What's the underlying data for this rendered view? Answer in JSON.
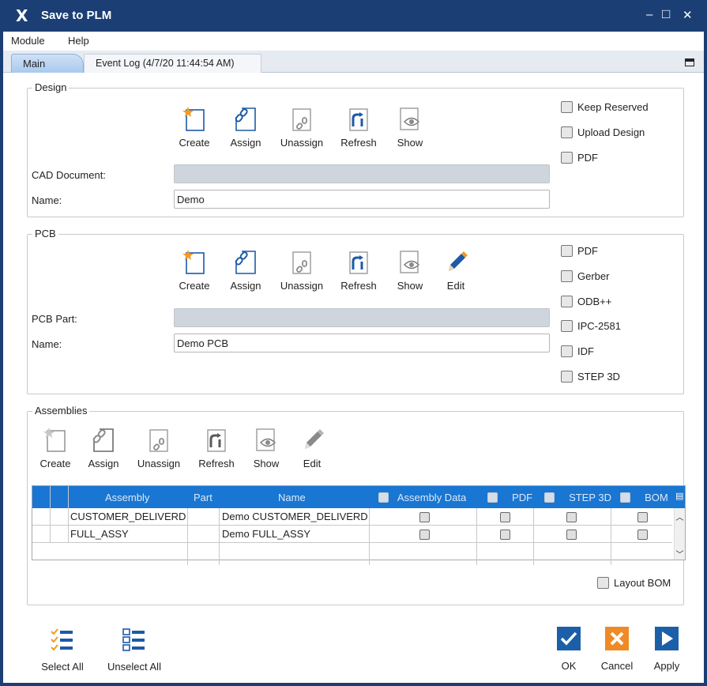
{
  "window": {
    "title": "Save to PLM",
    "minimize": "–",
    "maximize": "□",
    "close": "✕"
  },
  "menu": {
    "module": "Module",
    "help": "Help"
  },
  "tabs": {
    "main": "Main",
    "event_log": "Event Log (4/7/20 11:44:54 AM)"
  },
  "design": {
    "group_label": "Design",
    "toolbar": {
      "create": "Create",
      "assign": "Assign",
      "unassign": "Unassign",
      "refresh": "Refresh",
      "show": "Show"
    },
    "cad_label": "CAD Document:",
    "cad_value": "",
    "name_label": "Name:",
    "name_value": "Demo",
    "options": {
      "keep_reserved": "Keep Reserved",
      "upload_design": "Upload Design",
      "pdf": "PDF"
    }
  },
  "pcb": {
    "group_label": "PCB",
    "toolbar": {
      "create": "Create",
      "assign": "Assign",
      "unassign": "Unassign",
      "refresh": "Refresh",
      "show": "Show",
      "edit": "Edit"
    },
    "part_label": "PCB Part:",
    "part_value": "",
    "name_label": "Name:",
    "name_value": "Demo PCB",
    "options": {
      "pdf": "PDF",
      "gerber": "Gerber",
      "odb": "ODB++",
      "ipc": "IPC-2581",
      "idf": "IDF",
      "step": "STEP 3D"
    }
  },
  "assemblies": {
    "group_label": "Assemblies",
    "toolbar": {
      "create": "Create",
      "assign": "Assign",
      "unassign": "Unassign",
      "refresh": "Refresh",
      "show": "Show",
      "edit": "Edit"
    },
    "columns": {
      "assembly": "Assembly",
      "part": "Part",
      "name": "Name",
      "assembly_data": "Assembly Data",
      "pdf": "PDF",
      "step": "STEP 3D",
      "bom": "BOM"
    },
    "rows": [
      {
        "assembly": "CUSTOMER_DELIVERD",
        "part": "",
        "name": "Demo CUSTOMER_DELIVERD"
      },
      {
        "assembly": "FULL_ASSY",
        "part": "",
        "name": "Demo FULL_ASSY"
      }
    ],
    "layout_bom": "Layout BOM"
  },
  "footer": {
    "select_all": "Select All",
    "unselect_all": "Unselect All",
    "ok": "OK",
    "cancel": "Cancel",
    "apply": "Apply"
  },
  "colors": {
    "titlebar": "#1b3f74",
    "grid_header": "#1976d2",
    "ok": "#1b5fa8",
    "cancel": "#f08a24",
    "apply": "#1b5fa8"
  }
}
